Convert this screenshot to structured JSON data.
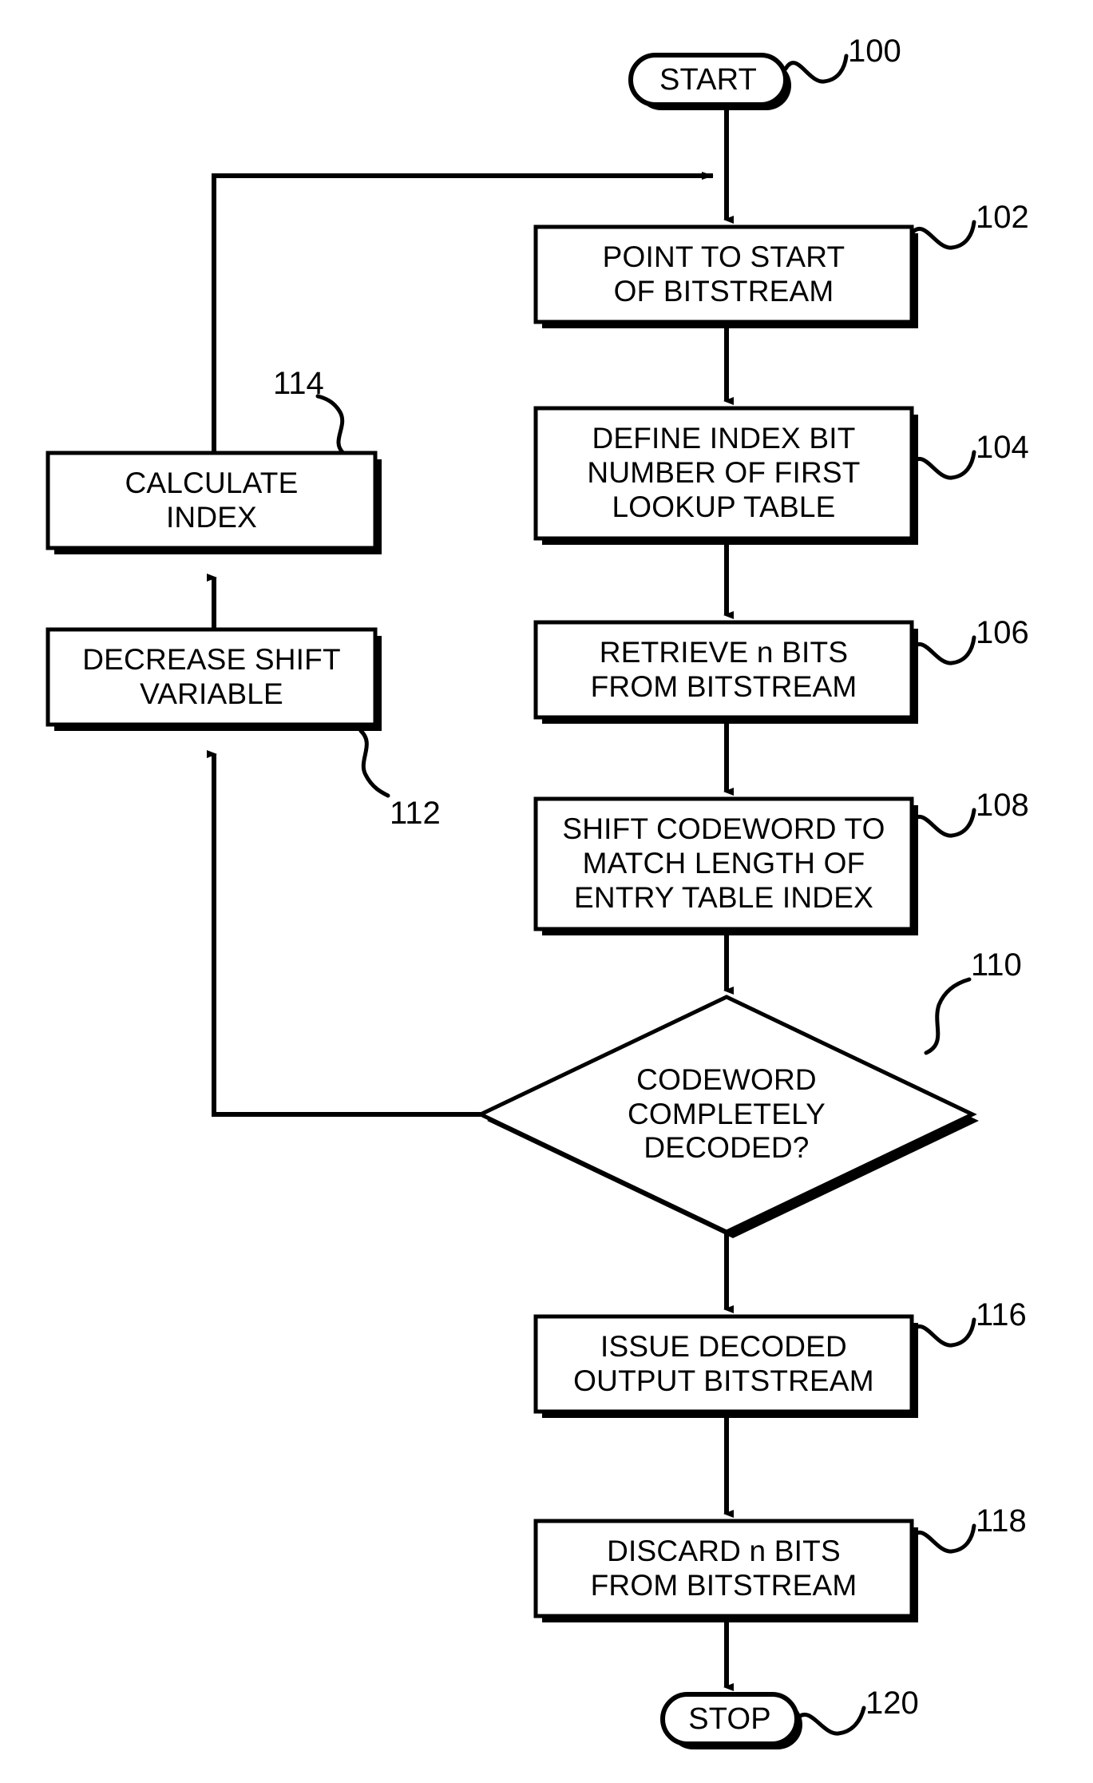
{
  "figure": {
    "type": "flowchart",
    "title": "Bitstream decoding flowchart",
    "background_color": "#ffffff",
    "line_color": "#000000"
  },
  "nodes": [
    {
      "id": "start",
      "shape": "terminator",
      "ref": "100",
      "lines": [
        "START"
      ],
      "text": "START"
    },
    {
      "id": "point_to_start",
      "shape": "process",
      "ref": "102",
      "lines": [
        "POINT TO START",
        "OF BITSTREAM"
      ]
    },
    {
      "id": "define_index_bit",
      "shape": "process",
      "ref": "104",
      "lines": [
        "DEFINE INDEX BIT",
        "NUMBER OF FIRST",
        "LOOKUP TABLE"
      ]
    },
    {
      "id": "retrieve_bits",
      "shape": "process",
      "ref": "106",
      "lines": [
        "RETRIEVE n BITS",
        "FROM BITSTREAM"
      ]
    },
    {
      "id": "shift_codeword",
      "shape": "process",
      "ref": "108",
      "lines": [
        "SHIFT CODEWORD TO",
        "MATCH LENGTH OF",
        "ENTRY TABLE INDEX"
      ]
    },
    {
      "id": "codeword_decoded",
      "shape": "decision",
      "ref": "110",
      "lines": [
        "CODEWORD",
        "COMPLETELY",
        "DECODED?"
      ]
    },
    {
      "id": "calculate_index",
      "shape": "process",
      "ref": "114",
      "lines": [
        "CALCULATE",
        "INDEX"
      ]
    },
    {
      "id": "decrease_shift_variable",
      "shape": "process",
      "ref": "112",
      "lines": [
        "DECREASE SHIFT",
        "VARIABLE"
      ]
    },
    {
      "id": "issue_decoded_output",
      "shape": "process",
      "ref": "116",
      "lines": [
        "ISSUE DECODED",
        "OUTPUT BITSTREAM"
      ]
    },
    {
      "id": "discard_bits",
      "shape": "process",
      "ref": "118",
      "lines": [
        "DISCARD n BITS",
        "FROM BITSTREAM"
      ]
    },
    {
      "id": "stop",
      "shape": "terminator",
      "ref": "120",
      "lines": [
        "STOP"
      ],
      "text": "STOP"
    }
  ],
  "labels": {
    "start_line1": "START",
    "stop_line1": "STOP",
    "box102_line1": "POINT TO START",
    "box102_line2": "OF BITSTREAM",
    "box104_line1": "DEFINE INDEX BIT",
    "box104_line2": "NUMBER OF FIRST",
    "box104_line3": "LOOKUP TABLE",
    "box106_line1": "RETRIEVE n BITS",
    "box106_line2": "FROM BITSTREAM",
    "box108_line1": "SHIFT CODEWORD TO",
    "box108_line2": "MATCH LENGTH OF",
    "box108_line3": "ENTRY TABLE INDEX",
    "diamond110_line1": "CODEWORD",
    "diamond110_line2": "COMPLETELY",
    "diamond110_line3": "DECODED?",
    "box114_line1": "CALCULATE",
    "box114_line2": "INDEX",
    "box112_line1": "DECREASE SHIFT",
    "box112_line2": "VARIABLE",
    "box116_line1": "ISSUE DECODED",
    "box116_line2": "OUTPUT BITSTREAM",
    "box118_line1": "DISCARD n BITS",
    "box118_line2": "FROM BITSTREAM"
  },
  "references": {
    "start": "100",
    "box102": "102",
    "box104": "104",
    "box106": "106",
    "box108": "108",
    "diamond110": "110",
    "box112": "112",
    "box114": "114",
    "box116": "116",
    "box118": "118",
    "stop": "120"
  },
  "edges": [
    {
      "from": "start",
      "to": "point_to_start"
    },
    {
      "from": "point_to_start",
      "to": "define_index_bit"
    },
    {
      "from": "define_index_bit",
      "to": "retrieve_bits"
    },
    {
      "from": "retrieve_bits",
      "to": "shift_codeword"
    },
    {
      "from": "shift_codeword",
      "to": "codeword_decoded"
    },
    {
      "from": "codeword_decoded",
      "to": "decrease_shift_variable",
      "route": "left-up"
    },
    {
      "from": "decrease_shift_variable",
      "to": "calculate_index"
    },
    {
      "from": "calculate_index",
      "to": "point_to_start",
      "route": "up-right"
    },
    {
      "from": "codeword_decoded",
      "to": "issue_decoded_output"
    },
    {
      "from": "issue_decoded_output",
      "to": "discard_bits"
    },
    {
      "from": "discard_bits",
      "to": "stop"
    }
  ]
}
